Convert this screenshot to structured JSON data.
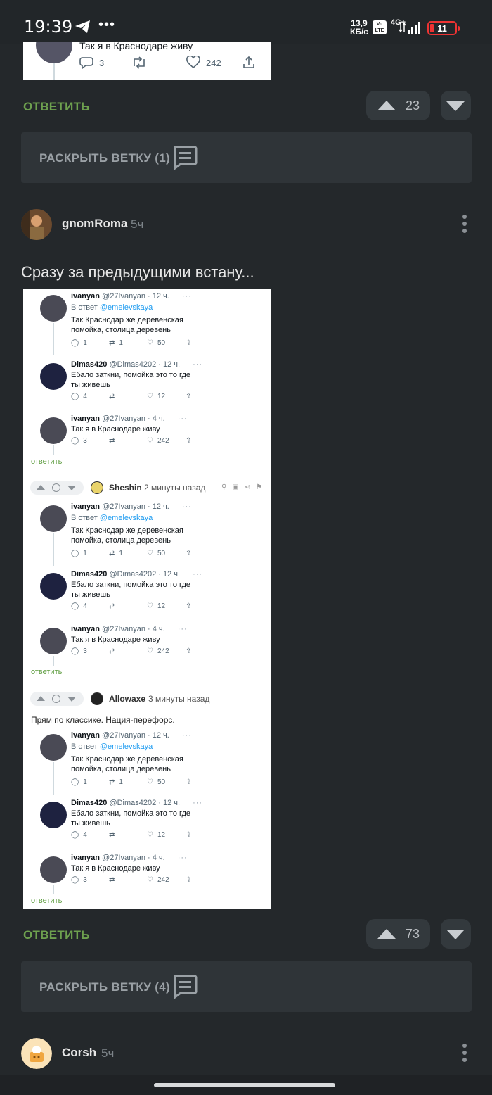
{
  "status_bar": {
    "time": "19:39",
    "speed_value": "13,9",
    "speed_unit": "КБ/с",
    "network": "4G+",
    "volte": "Vo LTE",
    "battery": "11",
    "more": "•••"
  },
  "top_embed": {
    "text": "Так я в Краснодаре живу",
    "replies": "3",
    "likes": "242"
  },
  "comment_1": {
    "reply_label": "ОТВЕТИТЬ",
    "votes": "23",
    "expand_label": "РАСКРЫТЬ ВЕТКУ (1)"
  },
  "comment_2": {
    "username": "gnomRoma",
    "time": "5ч",
    "text": "Сразу за предыдущими встану...",
    "reply_label": "ОТВЕТИТЬ",
    "votes": "73",
    "expand_label": "РАСКРЫТЬ ВЕТКУ (4)"
  },
  "comment_3": {
    "username": "Corsh",
    "time": "5ч"
  },
  "screenshot": {
    "tweet1": {
      "name": "ivanyan",
      "handle": "@27Ivanyan · 12 ч.",
      "in_reply_prefix": "В ответ",
      "in_reply_user": "@emelevskaya",
      "line1": "Так Краснодар же деревенская",
      "line2": "помойка, столица деревень",
      "replies": "1",
      "retweets": "1",
      "likes": "50"
    },
    "tweet2": {
      "name": "Dimas420",
      "handle": "@Dimas4202 · 12 ч.",
      "line1": "Ебало заткни, помойка это то где",
      "line2": "ты живешь",
      "replies": "4",
      "likes": "12"
    },
    "tweet3": {
      "name": "ivanyan",
      "handle": "@27Ivanyan · 4 ч.",
      "line1": "Так я в Краснодаре живу",
      "replies": "3",
      "likes": "242"
    },
    "reply_label": "ответить",
    "user_a": "Sheshin",
    "time_a": "2 минуты назад",
    "user_b": "Allowaxe",
    "time_b": "3 минуты назад",
    "text_b": "Прям по классике. Нация-перефорс.",
    "dots": "···"
  }
}
